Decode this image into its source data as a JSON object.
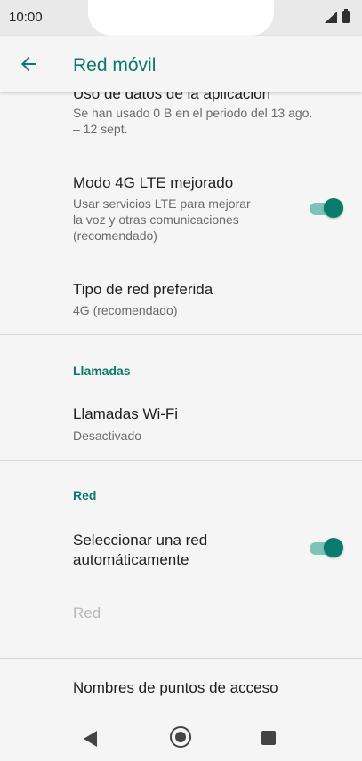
{
  "status_bar": {
    "time": "10:00"
  },
  "app_bar": {
    "title": "Red móvil"
  },
  "settings": {
    "data_usage": {
      "title": "Uso de datos de la aplicación",
      "summary_line1": "Se han usado 0 B en el periodo del 13 ago.",
      "summary_line2": "– 12 sept."
    },
    "lte": {
      "title": "Modo 4G LTE mejorado",
      "summary_line1": "Usar servicios LTE para mejorar",
      "summary_line2": "la voz y otras comunicaciones",
      "summary_line3": "(recomendado)",
      "enabled": true
    },
    "preferred_network": {
      "title": "Tipo de red preferida",
      "summary": "4G (recomendado)"
    },
    "calls_section": "Llamadas",
    "wifi_calling": {
      "title": "Llamadas Wi-Fi",
      "summary": "Desactivado"
    },
    "network_section": "Red",
    "auto_network": {
      "title_line1": "Seleccionar una red",
      "title_line2": "automáticamente",
      "enabled": true
    },
    "network": {
      "title": "Red"
    },
    "apn": {
      "title": "Nombres de puntos de acceso"
    }
  },
  "colors": {
    "accent": "#0a7a6c",
    "background": "#f5f5f5"
  }
}
